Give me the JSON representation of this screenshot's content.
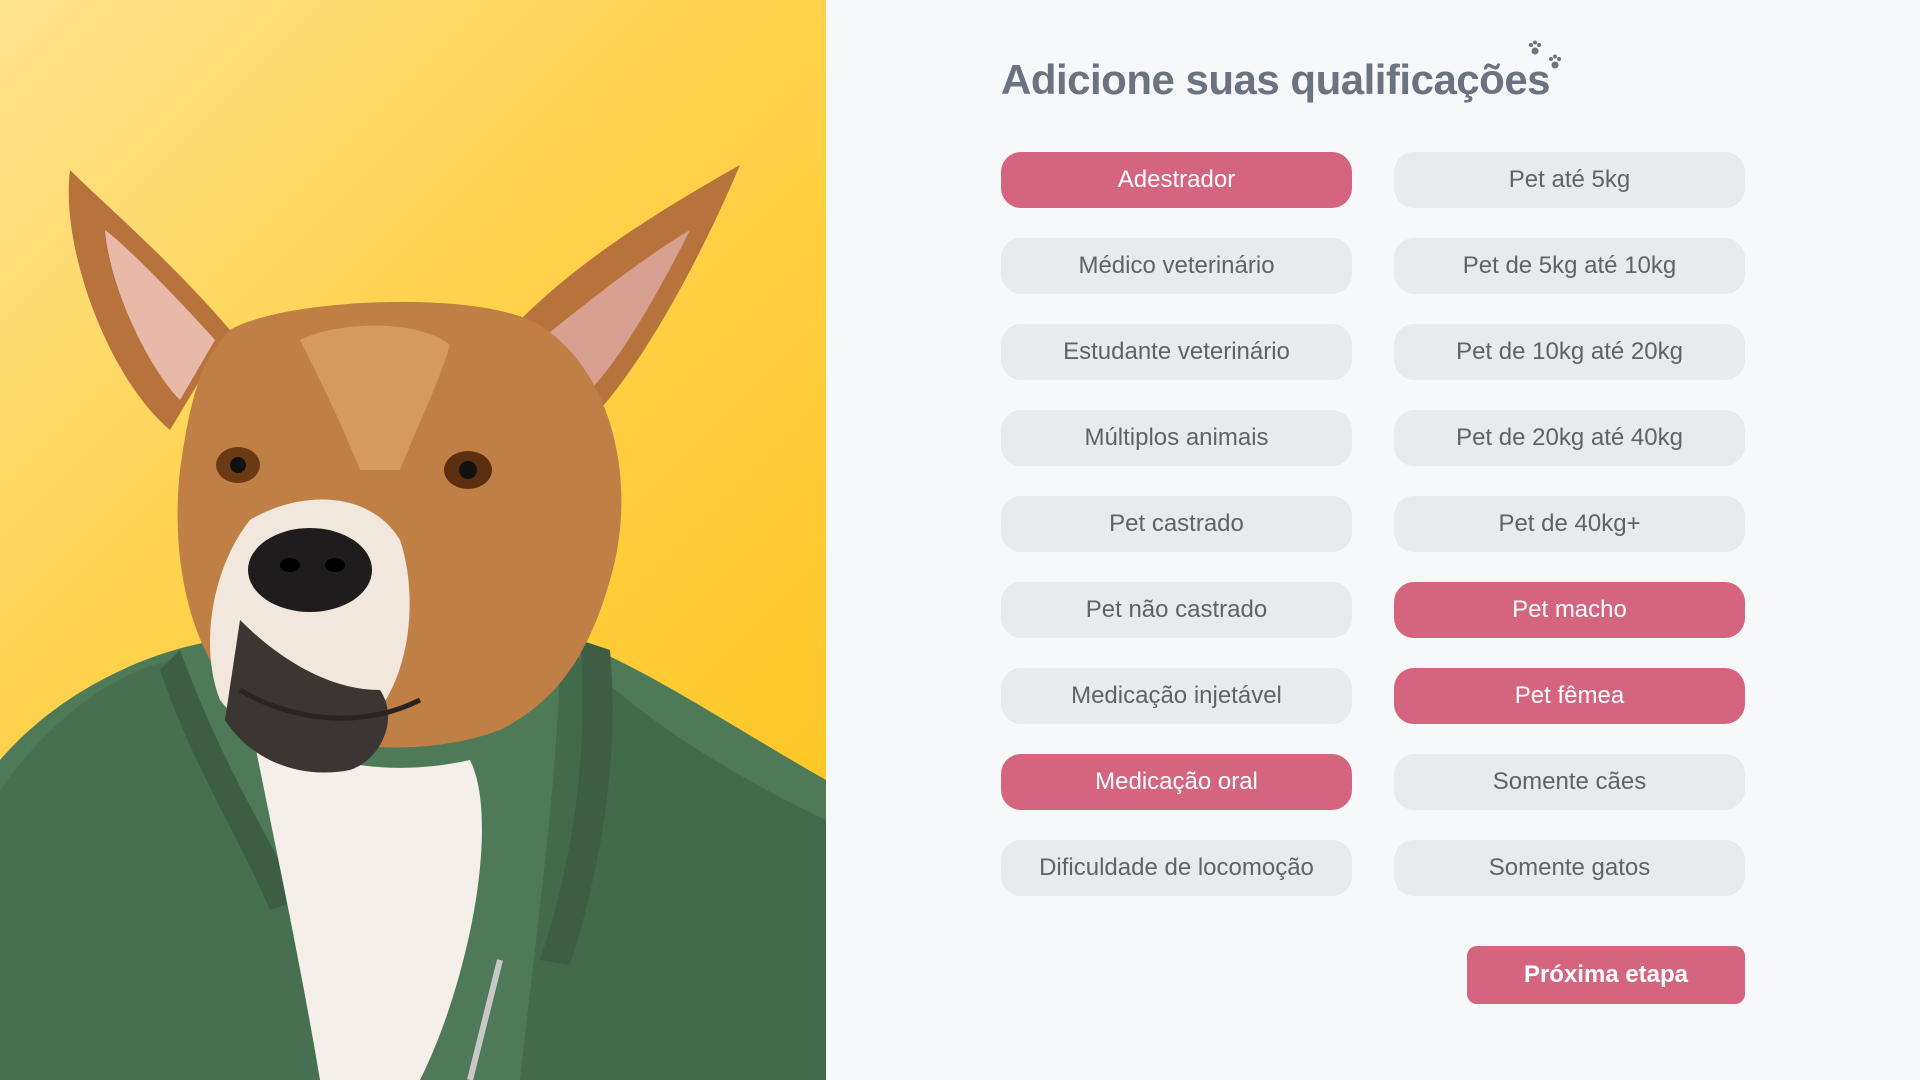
{
  "page": {
    "title": "Adicione suas qualificações"
  },
  "colors": {
    "accent": "#d5647e",
    "chip_bg": "#e8eaed",
    "chip_text": "#5f6368",
    "title": "#6b7280",
    "photo_bg": "#ffc41a"
  },
  "hero": {
    "image": "dog-in-green-jacket-photo",
    "icon": "paw-prints-icon"
  },
  "qualifications": {
    "left": [
      {
        "label": "Adestrador",
        "selected": true
      },
      {
        "label": "Médico veterinário",
        "selected": false
      },
      {
        "label": "Estudante veterinário",
        "selected": false
      },
      {
        "label": "Múltiplos animais",
        "selected": false
      },
      {
        "label": "Pet castrado",
        "selected": false
      },
      {
        "label": "Pet não castrado",
        "selected": false
      },
      {
        "label": "Medicação injetável",
        "selected": false
      },
      {
        "label": "Medicação oral",
        "selected": true
      },
      {
        "label": "Dificuldade de locomoção",
        "selected": false
      }
    ],
    "right": [
      {
        "label": "Pet até 5kg",
        "selected": false
      },
      {
        "label": "Pet de 5kg até 10kg",
        "selected": false
      },
      {
        "label": "Pet de 10kg até 20kg",
        "selected": false
      },
      {
        "label": "Pet de 20kg até 40kg",
        "selected": false
      },
      {
        "label": "Pet de 40kg+",
        "selected": false
      },
      {
        "label": "Pet macho",
        "selected": true
      },
      {
        "label": "Pet fêmea",
        "selected": true
      },
      {
        "label": "Somente cães",
        "selected": false
      },
      {
        "label": "Somente gatos",
        "selected": false
      }
    ]
  },
  "actions": {
    "next_label": "Próxima etapa"
  }
}
